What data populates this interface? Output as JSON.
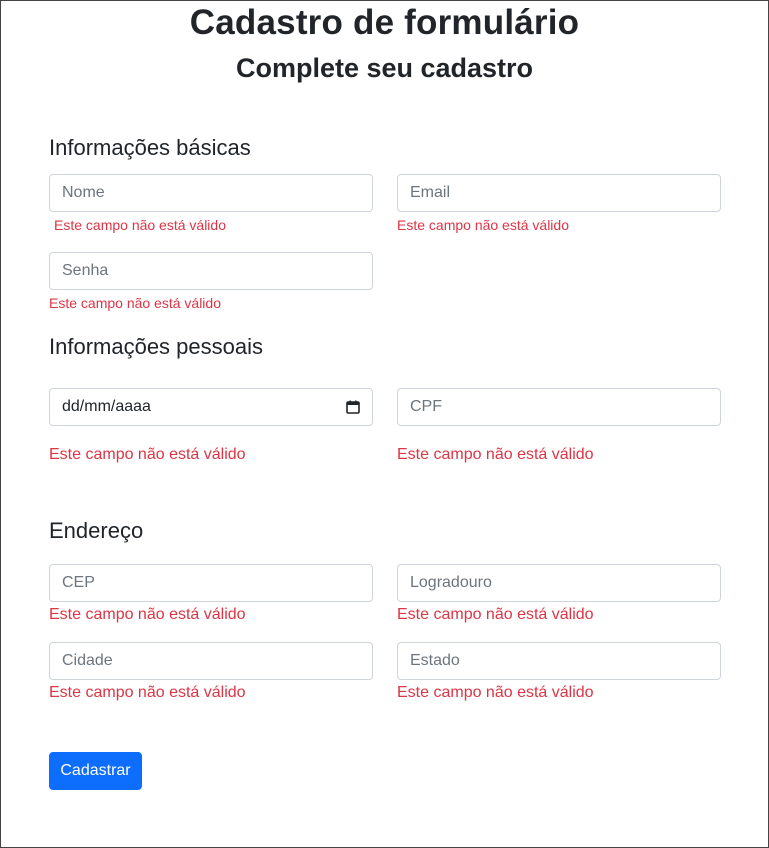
{
  "header": {
    "title": "Cadastro de formulário",
    "subtitle": "Complete seu cadastro"
  },
  "sections": {
    "basic": "Informações básicas",
    "personal": "Informações pessoais",
    "address": "Endereço"
  },
  "fields": {
    "nome": {
      "placeholder": "Nome",
      "error": "Este campo não está válido"
    },
    "email": {
      "placeholder": "Email",
      "error": "Este campo não está válido"
    },
    "senha": {
      "placeholder": "Senha",
      "error": "Este campo não está válido"
    },
    "nascimento": {
      "value": "dd/mm/aaaa",
      "icon": "calendar-icon",
      "error": "Este campo não está válido"
    },
    "cpf": {
      "placeholder": "CPF",
      "error": "Este campo não está válido"
    },
    "cep": {
      "placeholder": "CEP",
      "error": "Este campo não está válido"
    },
    "logradouro": {
      "placeholder": "Logradouro",
      "error": "Este campo não está válido"
    },
    "cidade": {
      "placeholder": "Cidade",
      "error": "Este campo não está válido"
    },
    "estado": {
      "placeholder": "Estado",
      "error": "Este campo não está válido"
    }
  },
  "submit": {
    "label": "Cadastrar"
  },
  "colors": {
    "primary": "#0d6efd",
    "error": "#dc3545",
    "border": "#ced4da",
    "placeholder": "#6c757d",
    "text": "#212529"
  }
}
